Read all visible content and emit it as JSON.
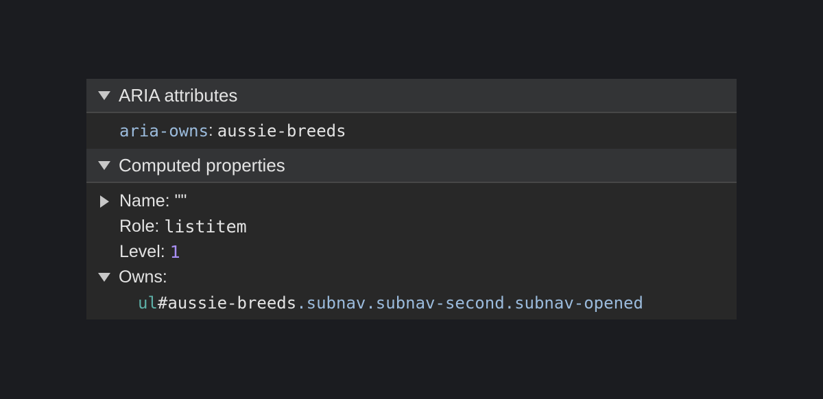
{
  "aria_section": {
    "title": "ARIA attributes",
    "attribute": {
      "name": "aria-owns",
      "separator": ":",
      "value": "aussie-breeds"
    }
  },
  "computed_section": {
    "title": "Computed properties",
    "name": {
      "label": "Name:",
      "value": "\"\""
    },
    "role": {
      "label": "Role:",
      "value": "listitem"
    },
    "level": {
      "label": "Level:",
      "value": "1"
    },
    "owns": {
      "label": "Owns:",
      "element": {
        "tag": "ul",
        "id": "#aussie-breeds",
        "classes": ".subnav.subnav-second.subnav-opened"
      }
    }
  },
  "colors": {
    "attribute_name": "#9bbbdc",
    "number": "#a98ff5",
    "tag": "#5db0a7",
    "header_bg": "#333436",
    "panel_bg": "#282828",
    "page_bg": "#1b1c20"
  }
}
